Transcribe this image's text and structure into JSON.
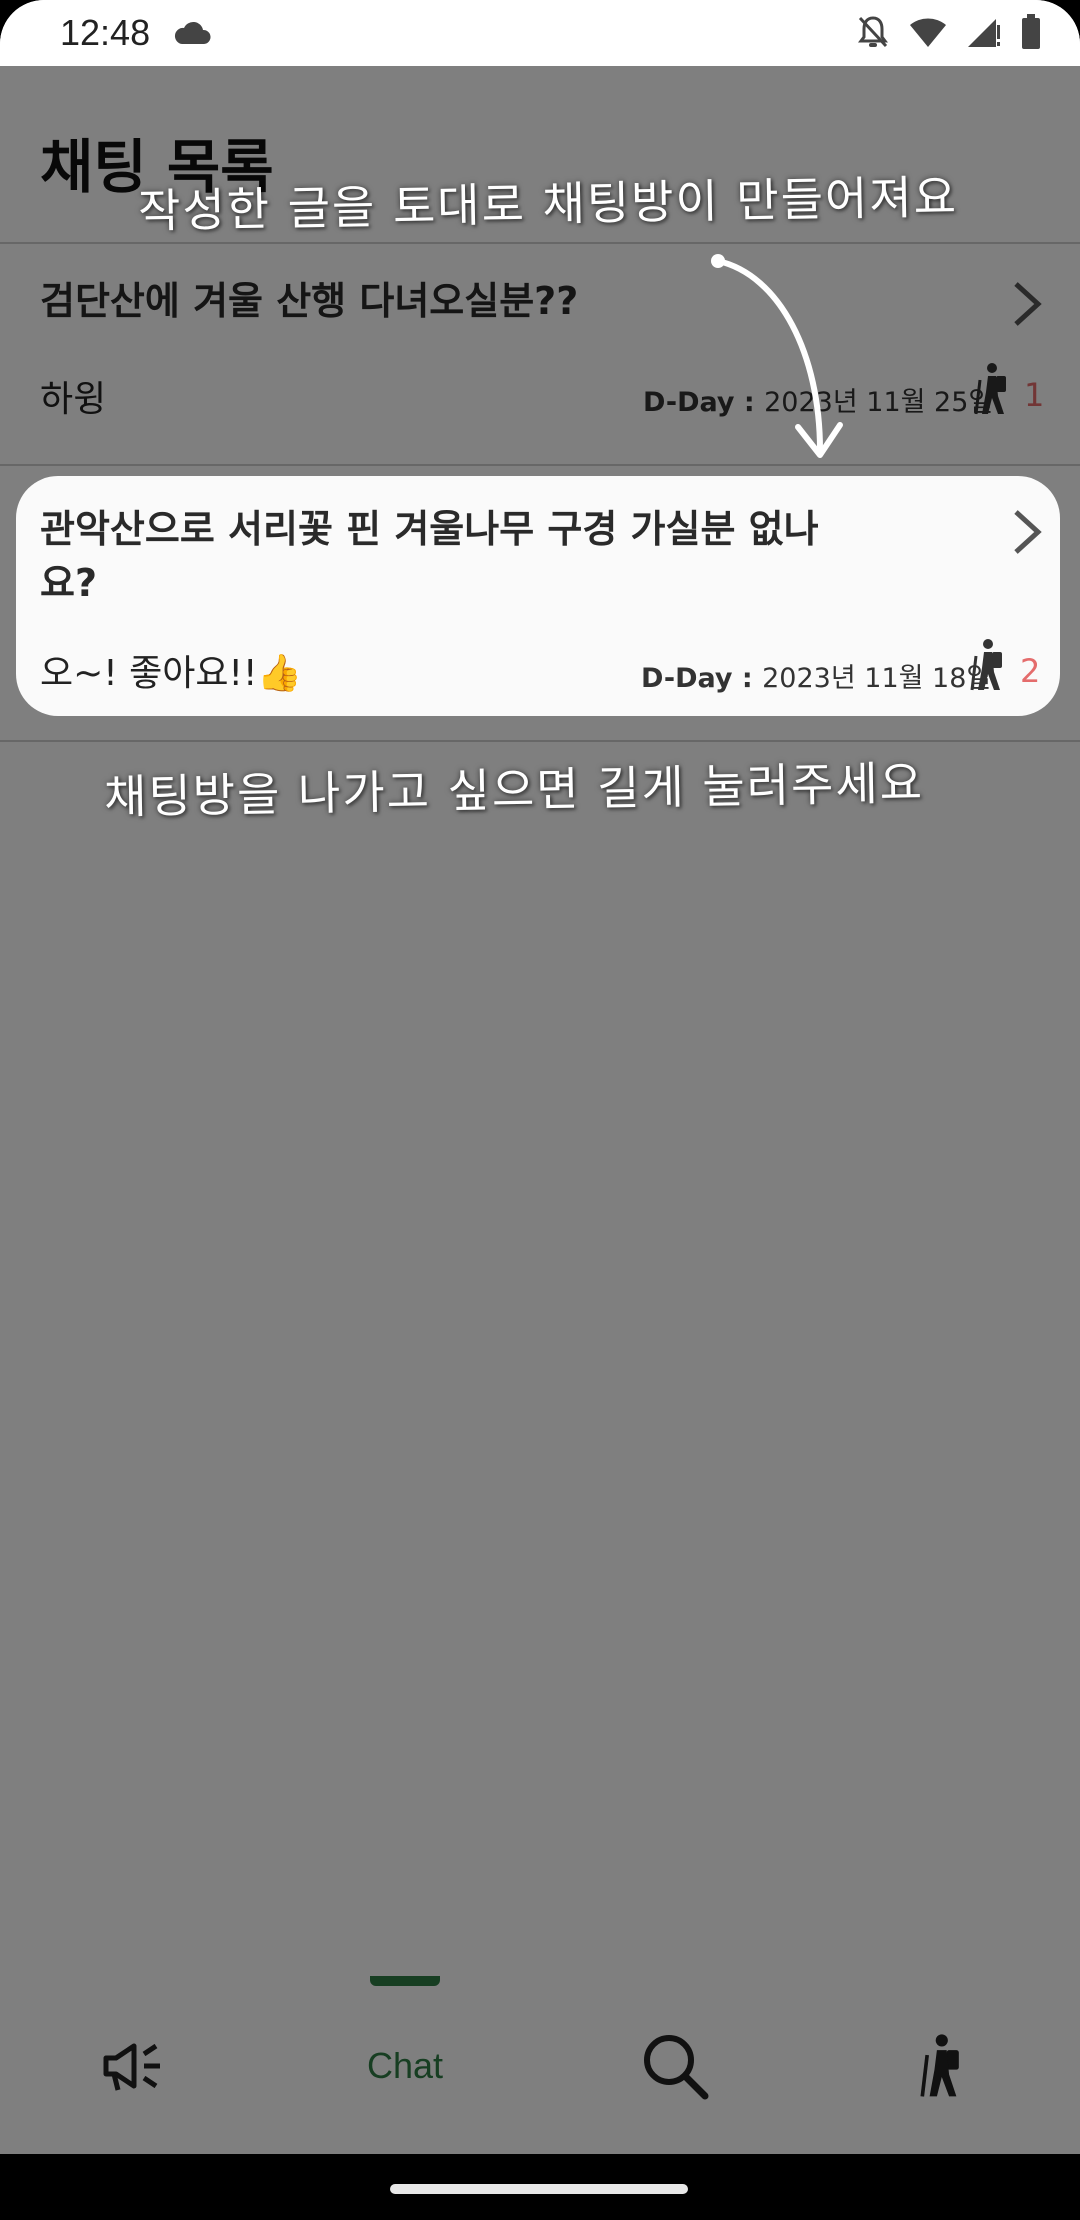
{
  "status_bar": {
    "time": "12:48",
    "icons": [
      "cloud-icon",
      "bell-off-icon",
      "wifi-icon",
      "signal-icon",
      "battery-icon"
    ]
  },
  "header": {
    "title": "채팅 목록"
  },
  "chat_rooms": [
    {
      "title": "검단산에 겨울 산행 다녀오실분??",
      "last_message": "하윙",
      "dday_label": "D-Day : ",
      "dday_date": "2023년 11월 25일",
      "participants": "1"
    },
    {
      "title": "관악산으로 서리꽃 핀 겨울나무 구경 가실분 없나요?",
      "last_message": "오~! 좋아요!!👍",
      "dday_label": "D-Day : ",
      "dday_date": "2023년 11월 18일",
      "participants": "2"
    }
  ],
  "annotations": {
    "top": "작성한 글을 토대로 채팅방이 만들어져요",
    "bottom": "채팅방을 나가고 싶으면 길게 눌러주세요"
  },
  "bottom_nav": {
    "items": [
      {
        "icon": "megaphone-icon",
        "label": ""
      },
      {
        "icon": "chat",
        "label": "Chat"
      },
      {
        "icon": "search-icon",
        "label": ""
      },
      {
        "icon": "hiker-icon",
        "label": ""
      }
    ],
    "active": "Chat"
  },
  "colors": {
    "accent": "#2e7d45",
    "count": "#e46c6c",
    "overlay": "rgba(0,0,0,0.5)"
  }
}
